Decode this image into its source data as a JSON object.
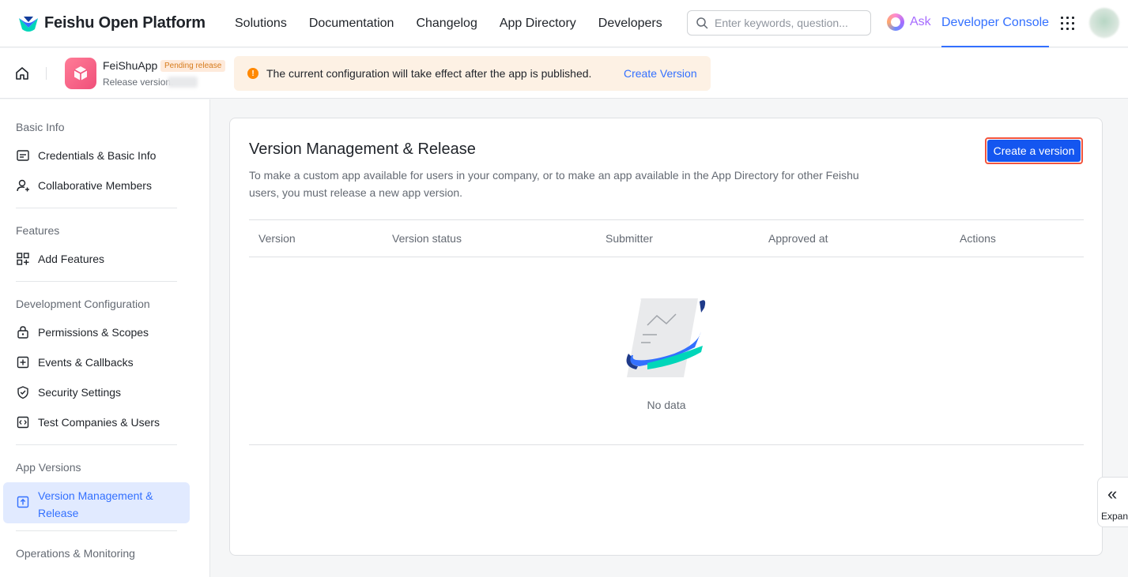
{
  "topnav": {
    "brand": "Feishu Open Platform",
    "links": [
      "Solutions",
      "Documentation",
      "Changelog",
      "App Directory",
      "Developers"
    ],
    "search_placeholder": "Enter keywords, question...",
    "ask_label": "Ask",
    "developer_console": "Developer Console"
  },
  "appbar": {
    "app_name": "FeiShuApp",
    "badge": "Pending release",
    "release_version": "Release version:",
    "notice_text": "The current configuration will take effect after the app is published.",
    "notice_link": "Create Version"
  },
  "sidebar": {
    "groups": {
      "basic": "Basic Info",
      "features": "Features",
      "dev_config": "Development Configuration",
      "versions": "App Versions",
      "ops": "Operations & Monitoring"
    },
    "items": {
      "credentials": "Credentials & Basic Info",
      "members": "Collaborative Members",
      "add_features": "Add Features",
      "permissions": "Permissions & Scopes",
      "events": "Events & Callbacks",
      "security": "Security Settings",
      "test": "Test Companies & Users",
      "version_mgmt": "Version Management & Release"
    }
  },
  "main": {
    "title": "Version Management & Release",
    "description": "To make a custom app available for users in your company, or to make an app available in the App Directory for other Feishu users, you must release a new app version.",
    "create_button": "Create a version",
    "columns": [
      "Version",
      "Version status",
      "Submitter",
      "Approved at",
      "Actions"
    ],
    "empty_text": "No data"
  },
  "expand": {
    "label": "Expand"
  },
  "colors": {
    "accent": "#3370ff",
    "primary_button": "#1456f0",
    "highlight_border": "#f2543d",
    "warning": "#ff8800"
  }
}
